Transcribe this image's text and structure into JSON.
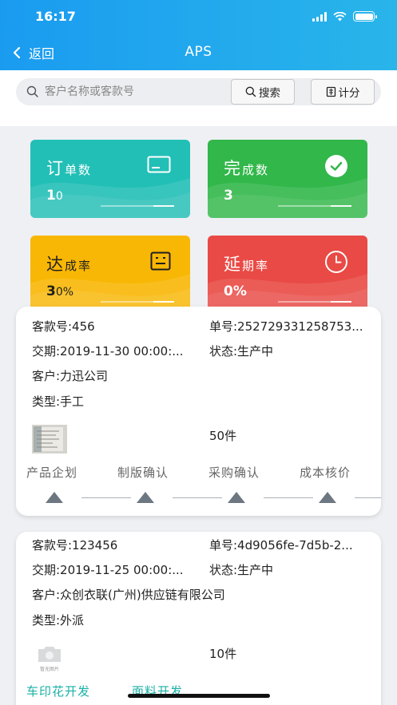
{
  "status_bar": {
    "time": "16:17"
  },
  "nav": {
    "back_label": "返回",
    "title": "APS"
  },
  "search": {
    "placeholder": "客户名称或客款号",
    "value": "",
    "search_button": "搜索",
    "stats_button": "计分"
  },
  "stats": [
    {
      "label_first": "订",
      "label_rest": "单数",
      "value_first": "1",
      "value_rest": "0",
      "color": "#22bfb6",
      "icon": "card-icon"
    },
    {
      "label_first": "完",
      "label_rest": "成数",
      "value_first": "3",
      "value_rest": "",
      "color": "#32b74a",
      "icon": "check-circle-icon"
    },
    {
      "label_first": "达",
      "label_rest": "成率",
      "value_first": "3",
      "value_rest": "0%",
      "color": "#f9b705",
      "icon": "list-box-icon"
    },
    {
      "label_first": "延",
      "label_rest": "期率",
      "value_first": "0%",
      "value_rest": "",
      "color": "#e94a45",
      "icon": "clock-icon"
    }
  ],
  "orders": [
    {
      "style_no": "客款号:456",
      "order_no": "单号:252729331258753...",
      "delivery": "交期:2019-11-30 00:00:...",
      "status": "状态:生产中",
      "customer": "客户:力迅公司",
      "type": "类型:手工",
      "quantity": "50件",
      "stages": [
        "产品企划",
        "制版确认",
        "采购确认",
        "成本核价"
      ]
    },
    {
      "style_no": "客款号:123456",
      "order_no": "单号:4d9056fe-7d5b-2...",
      "delivery": "交期:2019-11-25 00:00:...",
      "status": "状态:生产中",
      "customer": "客户:众创衣联(广州)供应链有限公司",
      "type": "类型:外派",
      "quantity": "10件",
      "photo_placeholder": "暂无图片",
      "stages": [
        "车印花开发",
        "面料开发"
      ]
    }
  ],
  "colors": {
    "header_start": "#1a9bf0",
    "header_end": "#29b5ea",
    "stage_active": "#1ab0a5",
    "stage_marker": "#6d7781"
  }
}
